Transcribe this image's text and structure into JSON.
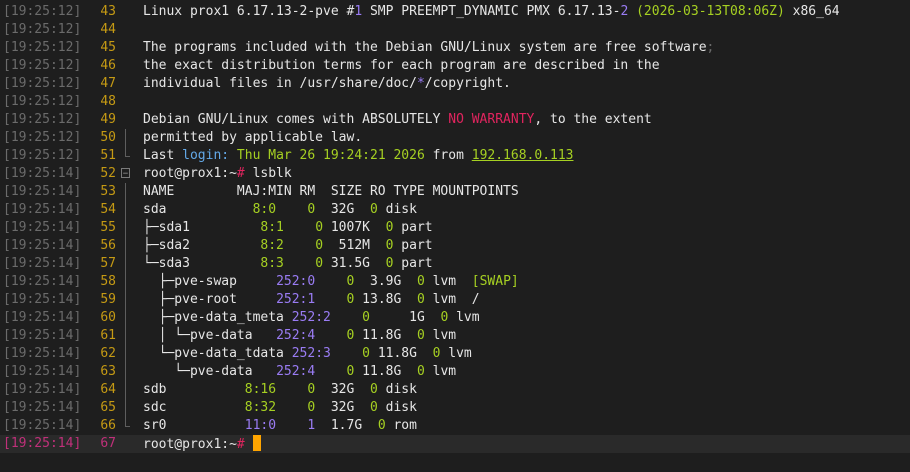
{
  "colors": {
    "background": "#1e1e1e",
    "timestamp": "#6b6b6b",
    "line_number": "#c59a14",
    "current_line_accent": "#c0307a",
    "text": "#e6e6e6",
    "green": "#a6d022",
    "red": "#e0245e",
    "purple": "#9a7cf4",
    "blue": "#63a9e8",
    "cursor": "#ffa500"
  },
  "lines": [
    {
      "ts": "[19:25:12]",
      "n": "43",
      "fold": "none",
      "segs": [
        {
          "t": "Linux prox1 6.17.13-2-pve #"
        },
        {
          "t": "1",
          "c": "purple"
        },
        {
          "t": " SMP PREEMPT_DYNAMIC PMX 6.17.13-"
        },
        {
          "t": "2",
          "c": "purple"
        },
        {
          "t": " "
        },
        {
          "t": "(2026-03-13T08:06Z)",
          "c": "green"
        },
        {
          "t": " x86_64"
        }
      ]
    },
    {
      "ts": "[19:25:12]",
      "n": "44",
      "fold": "none",
      "segs": []
    },
    {
      "ts": "[19:25:12]",
      "n": "45",
      "fold": "none",
      "segs": [
        {
          "t": "The programs included with the Debian GNU/Linux system are free software"
        },
        {
          "t": ";",
          "c": "gray"
        }
      ]
    },
    {
      "ts": "[19:25:12]",
      "n": "46",
      "fold": "none",
      "segs": [
        {
          "t": "the exact distribution terms for each program are described in the"
        }
      ]
    },
    {
      "ts": "[19:25:12]",
      "n": "47",
      "fold": "none",
      "segs": [
        {
          "t": "individual files in /usr/share/doc/"
        },
        {
          "t": "*",
          "c": "purple"
        },
        {
          "t": "/copyright."
        }
      ]
    },
    {
      "ts": "[19:25:12]",
      "n": "48",
      "fold": "none",
      "segs": []
    },
    {
      "ts": "[19:25:12]",
      "n": "49",
      "fold": "none",
      "segs": [
        {
          "t": "Debian GNU/Linux comes with ABSOLUTELY "
        },
        {
          "t": "NO WARRANTY",
          "c": "red"
        },
        {
          "t": ", to the extent"
        }
      ]
    },
    {
      "ts": "[19:25:12]",
      "n": "50",
      "fold": "mid",
      "segs": [
        {
          "t": "permitted by applicable law."
        }
      ]
    },
    {
      "ts": "[19:25:12]",
      "n": "51",
      "fold": "end",
      "segs": [
        {
          "t": "Last "
        },
        {
          "t": "login:",
          "c": "blue"
        },
        {
          "t": " Thu Mar 26 19:24:21 2026",
          "c": "green"
        },
        {
          "t": " from "
        },
        {
          "t": "192.168.0.113",
          "c": "ulgreen"
        }
      ]
    },
    {
      "ts": "[19:25:14]",
      "n": "52",
      "fold": "open",
      "segs": [
        {
          "t": "root@prox1:~"
        },
        {
          "t": "#",
          "c": "red"
        },
        {
          "t": " lsblk"
        }
      ]
    },
    {
      "ts": "[19:25:14]",
      "n": "53",
      "fold": "mid",
      "segs": [
        {
          "t": "NAME        MAJ:MIN RM  SIZE RO TYPE MOUNTPOINTS"
        }
      ]
    },
    {
      "ts": "[19:25:14]",
      "n": "54",
      "fold": "mid",
      "segs": [
        {
          "t": "sda           "
        },
        {
          "t": "8:0",
          "c": "green"
        },
        {
          "t": "    "
        },
        {
          "t": "0",
          "c": "green"
        },
        {
          "t": "  32G  "
        },
        {
          "t": "0",
          "c": "green"
        },
        {
          "t": " disk"
        }
      ]
    },
    {
      "ts": "[19:25:14]",
      "n": "55",
      "fold": "mid",
      "segs": [
        {
          "t": "├─sda1         "
        },
        {
          "t": "8:1",
          "c": "green"
        },
        {
          "t": "    "
        },
        {
          "t": "0",
          "c": "green"
        },
        {
          "t": " 1007K  "
        },
        {
          "t": "0",
          "c": "green"
        },
        {
          "t": " part"
        }
      ]
    },
    {
      "ts": "[19:25:14]",
      "n": "56",
      "fold": "mid",
      "segs": [
        {
          "t": "├─sda2         "
        },
        {
          "t": "8:2",
          "c": "green"
        },
        {
          "t": "    "
        },
        {
          "t": "0",
          "c": "green"
        },
        {
          "t": "  512M  "
        },
        {
          "t": "0",
          "c": "green"
        },
        {
          "t": " part"
        }
      ]
    },
    {
      "ts": "[19:25:14]",
      "n": "57",
      "fold": "mid",
      "segs": [
        {
          "t": "└─sda3         "
        },
        {
          "t": "8:3",
          "c": "green"
        },
        {
          "t": "    "
        },
        {
          "t": "0",
          "c": "green"
        },
        {
          "t": " 31.5G  "
        },
        {
          "t": "0",
          "c": "green"
        },
        {
          "t": " part"
        }
      ]
    },
    {
      "ts": "[19:25:14]",
      "n": "58",
      "fold": "mid",
      "segs": [
        {
          "t": "  ├─pve-swap     "
        },
        {
          "t": "252:0",
          "c": "purple"
        },
        {
          "t": "    "
        },
        {
          "t": "0",
          "c": "green"
        },
        {
          "t": "  3.9G  "
        },
        {
          "t": "0",
          "c": "green"
        },
        {
          "t": " lvm  "
        },
        {
          "t": "[SWAP]",
          "c": "green"
        }
      ]
    },
    {
      "ts": "[19:25:14]",
      "n": "59",
      "fold": "mid",
      "segs": [
        {
          "t": "  ├─pve-root     "
        },
        {
          "t": "252:1",
          "c": "purple"
        },
        {
          "t": "    "
        },
        {
          "t": "0",
          "c": "green"
        },
        {
          "t": " 13.8G  "
        },
        {
          "t": "0",
          "c": "green"
        },
        {
          "t": " lvm  /"
        }
      ]
    },
    {
      "ts": "[19:25:14]",
      "n": "60",
      "fold": "mid",
      "segs": [
        {
          "t": "  ├─pve-data_tmeta "
        },
        {
          "t": "252:2",
          "c": "purple"
        },
        {
          "t": "    "
        },
        {
          "t": "0",
          "c": "green"
        },
        {
          "t": "     1G  "
        },
        {
          "t": "0",
          "c": "green"
        },
        {
          "t": " lvm"
        }
      ]
    },
    {
      "ts": "[19:25:14]",
      "n": "61",
      "fold": "mid",
      "segs": [
        {
          "t": "  │ └─pve-data   "
        },
        {
          "t": "252:4",
          "c": "purple"
        },
        {
          "t": "    "
        },
        {
          "t": "0",
          "c": "green"
        },
        {
          "t": " 11.8G  "
        },
        {
          "t": "0",
          "c": "green"
        },
        {
          "t": " lvm"
        }
      ]
    },
    {
      "ts": "[19:25:14]",
      "n": "62",
      "fold": "mid",
      "segs": [
        {
          "t": "  └─pve-data_tdata "
        },
        {
          "t": "252:3",
          "c": "purple"
        },
        {
          "t": "    "
        },
        {
          "t": "0",
          "c": "green"
        },
        {
          "t": " 11.8G  "
        },
        {
          "t": "0",
          "c": "green"
        },
        {
          "t": " lvm"
        }
      ]
    },
    {
      "ts": "[19:25:14]",
      "n": "63",
      "fold": "mid",
      "segs": [
        {
          "t": "    └─pve-data   "
        },
        {
          "t": "252:4",
          "c": "purple"
        },
        {
          "t": "    "
        },
        {
          "t": "0",
          "c": "green"
        },
        {
          "t": " 11.8G  "
        },
        {
          "t": "0",
          "c": "green"
        },
        {
          "t": " lvm"
        }
      ]
    },
    {
      "ts": "[19:25:14]",
      "n": "64",
      "fold": "mid",
      "segs": [
        {
          "t": "sdb          "
        },
        {
          "t": "8:16",
          "c": "green"
        },
        {
          "t": "    "
        },
        {
          "t": "0",
          "c": "green"
        },
        {
          "t": "  32G  "
        },
        {
          "t": "0",
          "c": "green"
        },
        {
          "t": " disk"
        }
      ]
    },
    {
      "ts": "[19:25:14]",
      "n": "65",
      "fold": "mid",
      "segs": [
        {
          "t": "sdc          "
        },
        {
          "t": "8:32",
          "c": "green"
        },
        {
          "t": "    "
        },
        {
          "t": "0",
          "c": "green"
        },
        {
          "t": "  32G  "
        },
        {
          "t": "0",
          "c": "green"
        },
        {
          "t": " disk"
        }
      ]
    },
    {
      "ts": "[19:25:14]",
      "n": "66",
      "fold": "end",
      "segs": [
        {
          "t": "sr0          "
        },
        {
          "t": "11:0",
          "c": "purple"
        },
        {
          "t": "    "
        },
        {
          "t": "1",
          "c": "purple"
        },
        {
          "t": "  1.7G  "
        },
        {
          "t": "0",
          "c": "green"
        },
        {
          "t": " rom"
        }
      ]
    },
    {
      "ts": "[19:25:14]",
      "n": "67",
      "fold": "none",
      "current": true,
      "segs": [
        {
          "t": "root@prox1:~"
        },
        {
          "t": "#",
          "c": "red"
        },
        {
          "t": " "
        }
      ]
    }
  ]
}
